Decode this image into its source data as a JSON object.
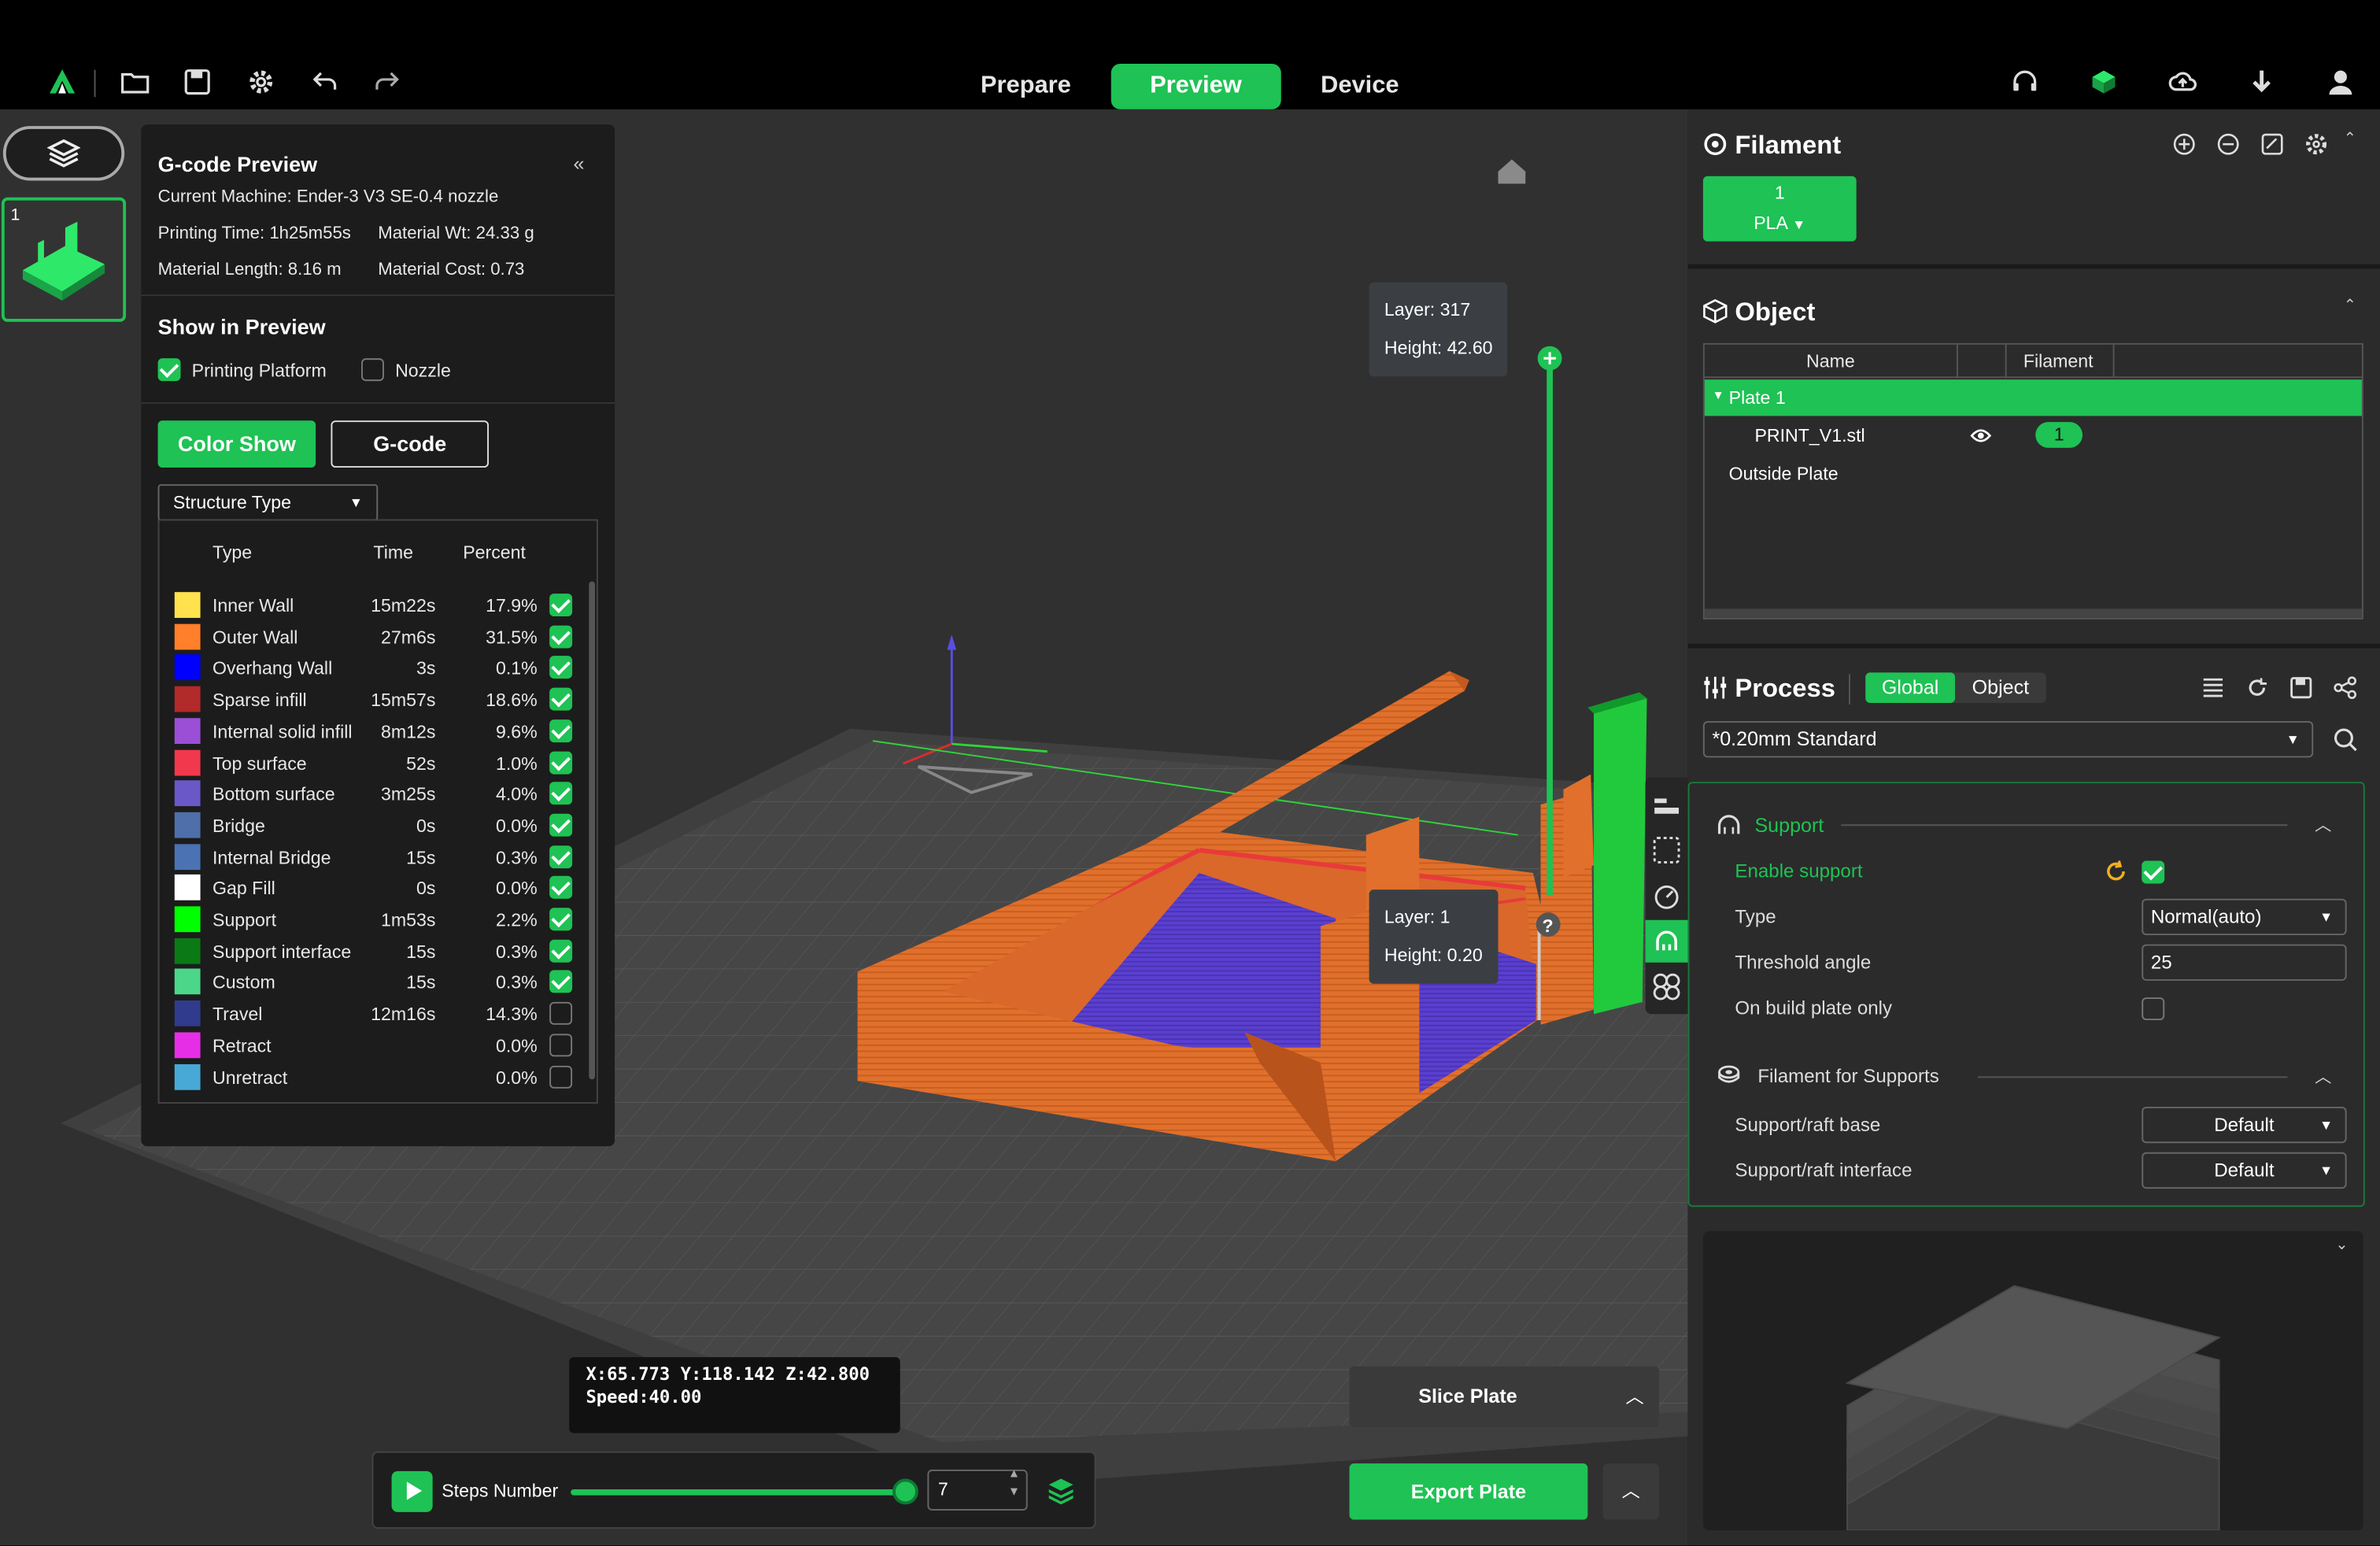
{
  "topbar": {
    "tabs": [
      "Prepare",
      "Preview",
      "Device"
    ],
    "active_tab": "Preview"
  },
  "plate_thumb": {
    "number": "1"
  },
  "gcode": {
    "title": "G-code Preview",
    "current_machine": "Current Machine: Ender-3 V3 SE-0.4 nozzle",
    "printing_time": "Printing Time: 1h25m55s",
    "material_wt": "Material Wt: 24.33 g",
    "material_length": "Material Length: 8.16 m",
    "material_cost": "Material Cost: 0.73",
    "show_in_preview": "Show in Preview",
    "printing_platform": "Printing Platform",
    "nozzle": "Nozzle",
    "color_show": "Color Show",
    "gcode_btn": "G-code",
    "structure_type": "Structure Type",
    "headers": {
      "type": "Type",
      "time": "Time",
      "percent": "Percent"
    },
    "rows": [
      {
        "label": "Inner Wall",
        "time": "15m22s",
        "percent": "17.9%",
        "color": "#FFE24D",
        "checked": true
      },
      {
        "label": "Outer Wall",
        "time": "27m6s",
        "percent": "31.5%",
        "color": "#FF7F2A",
        "checked": true
      },
      {
        "label": "Overhang Wall",
        "time": "3s",
        "percent": "0.1%",
        "color": "#0000FF",
        "checked": true
      },
      {
        "label": "Sparse infill",
        "time": "15m57s",
        "percent": "18.6%",
        "color": "#B22A2A",
        "checked": true
      },
      {
        "label": "Internal solid infill",
        "time": "8m12s",
        "percent": "9.6%",
        "color": "#9A4FD6",
        "checked": true
      },
      {
        "label": "Top surface",
        "time": "52s",
        "percent": "1.0%",
        "color": "#F2384C",
        "checked": true
      },
      {
        "label": "Bottom surface",
        "time": "3m25s",
        "percent": "4.0%",
        "color": "#6A58C9",
        "checked": true
      },
      {
        "label": "Bridge",
        "time": "0s",
        "percent": "0.0%",
        "color": "#4F6FAA",
        "checked": true
      },
      {
        "label": "Internal Bridge",
        "time": "15s",
        "percent": "0.3%",
        "color": "#4B72B2",
        "checked": true
      },
      {
        "label": "Gap Fill",
        "time": "0s",
        "percent": "0.0%",
        "color": "#FFFFFF",
        "checked": true
      },
      {
        "label": "Support",
        "time": "1m53s",
        "percent": "2.2%",
        "color": "#00FF00",
        "checked": true
      },
      {
        "label": "Support interface",
        "time": "15s",
        "percent": "0.3%",
        "color": "#0B7A15",
        "checked": true
      },
      {
        "label": "Custom",
        "time": "15s",
        "percent": "0.3%",
        "color": "#4CD68A",
        "checked": true
      },
      {
        "label": "Travel",
        "time": "12m16s",
        "percent": "14.3%",
        "color": "#303B8E",
        "checked": false
      },
      {
        "label": "Retract",
        "time": "",
        "percent": "0.0%",
        "color": "#E62EE6",
        "checked": false
      },
      {
        "label": "Unretract",
        "time": "",
        "percent": "0.0%",
        "color": "#48A9D6",
        "checked": false
      }
    ]
  },
  "layer_top": {
    "layer": "Layer: 317",
    "height": "Height: 42.60"
  },
  "layer_bottom": {
    "layer": "Layer: 1",
    "height": "Height: 0.20"
  },
  "coords": {
    "line1": "X:65.773  Y:118.142  Z:42.800",
    "line2": "Speed:40.00"
  },
  "steps": {
    "label": "Steps Number",
    "value": "7"
  },
  "actions": {
    "slice": "Slice Plate",
    "export": "Export Plate"
  },
  "filament": {
    "title": "Filament",
    "slot_number": "1",
    "slot_type": "PLA"
  },
  "object": {
    "title": "Object",
    "col_name": "Name",
    "col_filament": "Filament",
    "plate": "Plate 1",
    "file": "PRINT_V1.stl",
    "file_filament": "1",
    "outside": "Outside Plate"
  },
  "process": {
    "title": "Process",
    "global": "Global",
    "object": "Object",
    "preset": "*0.20mm Standard",
    "support_title": "Support",
    "enable_support": "Enable support",
    "type_label": "Type",
    "type_value": "Normal(auto)",
    "threshold_label": "Threshold angle",
    "threshold_value": "25",
    "build_plate_only": "On build plate only",
    "filament_supports": "Filament for Supports",
    "raft_base_label": "Support/raft base",
    "raft_base_value": "Default",
    "raft_interface_label": "Support/raft interface",
    "raft_interface_value": "Default"
  },
  "colors": {
    "accent": "#1FC254",
    "model_orange": "#E0702C",
    "model_blue": "#5A3FD0",
    "bed": "#4A4A4A"
  }
}
